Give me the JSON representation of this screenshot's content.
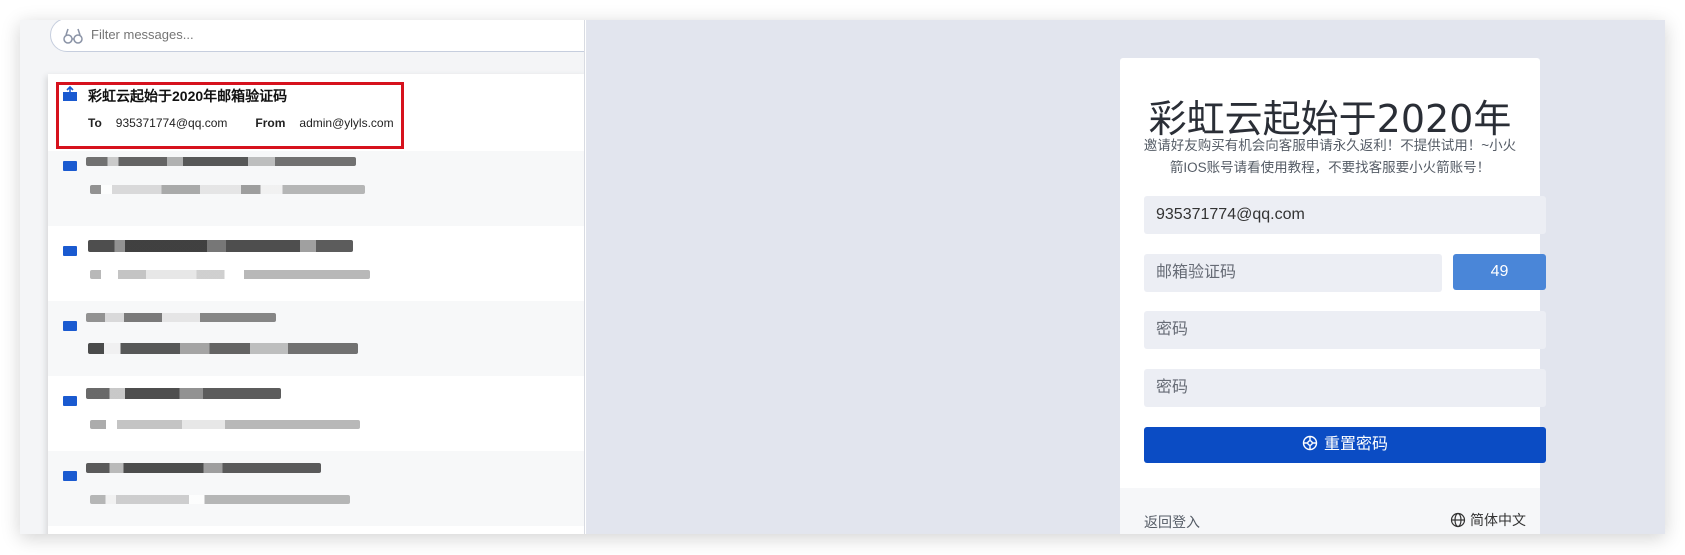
{
  "filter": {
    "placeholder": "Filter messages..."
  },
  "mail_list": {
    "highlighted": {
      "subject": "彩虹云起始于2020年邮箱验证码",
      "to_label": "To",
      "to_value": "935371774@qq.com",
      "from_label": "From",
      "from_value": "admin@ylyls.com"
    }
  },
  "reset_card": {
    "title": "彩虹云起始于2020年",
    "subtitle": "邀请好友购买有机会向客服申请永久返利！不提供试用！~小火箭IOS账号请看使用教程，不要找客服要小火箭账号！",
    "email_value": "935371774@qq.com",
    "code_placeholder": "邮箱验证码",
    "code_countdown": "49",
    "password_placeholder": "密码",
    "confirm_placeholder": "密码",
    "submit_label": "重置密码",
    "back_label": "返回登入",
    "language_label": "简体中文"
  },
  "colors": {
    "accent": "#0b4cc4",
    "countdown_button": "#4a86d8",
    "highlight_border": "#d6111d",
    "background": "#e2e5ee"
  },
  "icons": {
    "filter": "filter-icon",
    "submit": "reset-icon",
    "language": "globe-icon",
    "mail": "envelope-icon"
  }
}
